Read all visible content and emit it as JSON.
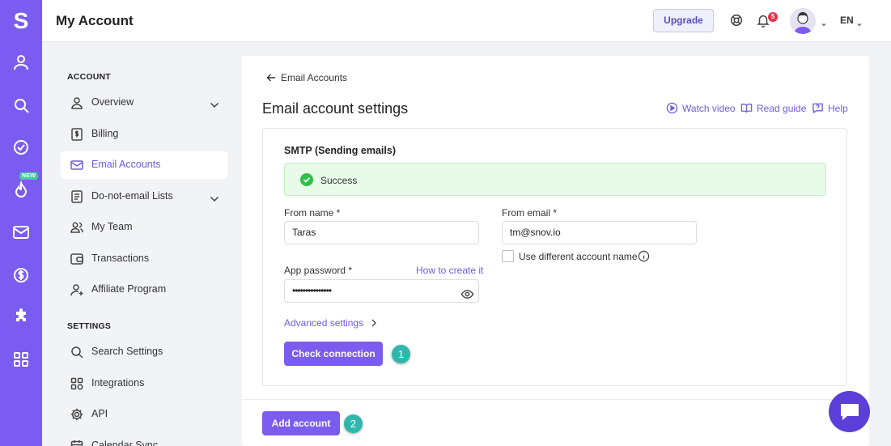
{
  "header": {
    "title": "My Account",
    "upgrade_label": "Upgrade",
    "notification_count": "5",
    "language": "EN"
  },
  "rail": {
    "logo": "S",
    "new_badge": "NEW",
    "icons": [
      "user-icon",
      "search-icon",
      "check-circle-icon",
      "flame-icon",
      "mail-icon",
      "dollar-icon",
      "puzzle-icon",
      "grid-icon"
    ]
  },
  "sidebar": {
    "account_heading": "ACCOUNT",
    "settings_heading": "SETTINGS",
    "account_items": [
      {
        "label": "Overview",
        "icon": "user-icon"
      },
      {
        "label": "Billing",
        "icon": "billing-icon"
      },
      {
        "label": "Email Accounts",
        "icon": "mail-icon"
      },
      {
        "label": "Do-not-email Lists",
        "icon": "list-icon"
      },
      {
        "label": "My Team",
        "icon": "team-icon"
      },
      {
        "label": "Transactions",
        "icon": "wallet-icon"
      },
      {
        "label": "Affiliate Program",
        "icon": "user-plus-icon"
      }
    ],
    "settings_items": [
      {
        "label": "Search Settings",
        "icon": "search-icon"
      },
      {
        "label": "Integrations",
        "icon": "integrations-icon"
      },
      {
        "label": "API",
        "icon": "gear-icon"
      },
      {
        "label": "Calendar Sync",
        "icon": "calendar-icon"
      }
    ],
    "active_item": "Email Accounts"
  },
  "main": {
    "back_label": "Email Accounts",
    "page_title": "Email account settings",
    "links": {
      "watch_video": "Watch video",
      "read_guide": "Read guide",
      "help": "Help"
    },
    "smtp": {
      "title": "SMTP (Sending emails)",
      "success_message": "Success",
      "from_name_label": "From name *",
      "from_name_value": "Taras",
      "from_email_label": "From email *",
      "from_email_value": "tm@snov.io",
      "use_different_name_label": "Use different account name",
      "app_password_label": "App password *",
      "how_to_create_label": "How to create it",
      "app_password_value": "•••••••••••••••",
      "advanced_settings_label": "Advanced settings",
      "check_connection_label": "Check connection"
    },
    "add_account_label": "Add account",
    "steps": [
      "1",
      "2"
    ]
  },
  "colors": {
    "brand": "#7b5cf0",
    "link": "#6f5be0",
    "success_bg": "#e7fbe8",
    "success_icon": "#2fbf4a",
    "step": "#2fb6ad",
    "badge": "#e8334a"
  }
}
